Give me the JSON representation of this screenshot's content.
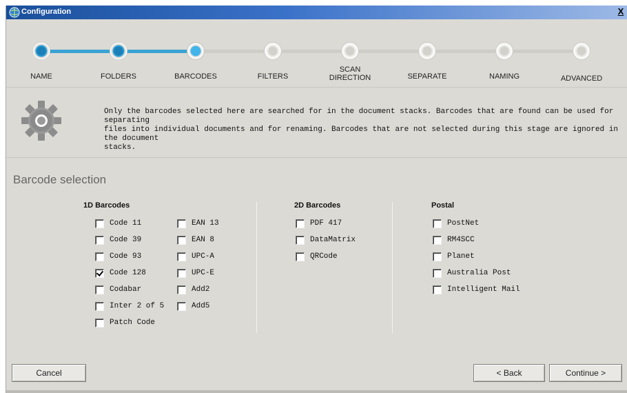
{
  "window": {
    "title": "Configuration",
    "close_label": "X"
  },
  "steps": [
    {
      "label": "NAME",
      "state": "done"
    },
    {
      "label": "FOLDERS",
      "state": "done"
    },
    {
      "label": "BARCODES",
      "state": "current"
    },
    {
      "label": "FILTERS",
      "state": "todo"
    },
    {
      "label": "SCAN\nDIRECTION",
      "state": "todo"
    },
    {
      "label": "SEPARATE",
      "state": "todo"
    },
    {
      "label": "NAMING",
      "state": "todo"
    },
    {
      "label": "ADVANCED",
      "state": "todo"
    }
  ],
  "info": {
    "icon": "gear-icon",
    "text": "Only the barcodes selected here are searched for in the document stacks. Barcodes that are found can be used for separating\nfiles into individual documents and for renaming. Barcodes that are not selected during this stage are ignored in the document\nstacks."
  },
  "section_title": "Barcode selection",
  "groups": {
    "oned": {
      "title": "1D Barcodes",
      "items": [
        {
          "label": "Code 11",
          "checked": false
        },
        {
          "label": "Code 39",
          "checked": false
        },
        {
          "label": "Code 93",
          "checked": false
        },
        {
          "label": "Code 128",
          "checked": true
        },
        {
          "label": "Codabar",
          "checked": false
        },
        {
          "label": "Inter 2 of 5",
          "checked": false
        },
        {
          "label": "Patch Code",
          "checked": false
        },
        {
          "label": "EAN 13",
          "checked": false
        },
        {
          "label": "EAN 8",
          "checked": false
        },
        {
          "label": "UPC-A",
          "checked": false
        },
        {
          "label": "UPC-E",
          "checked": false
        },
        {
          "label": "Add2",
          "checked": false
        },
        {
          "label": "Add5",
          "checked": false
        }
      ]
    },
    "twod": {
      "title": "2D Barcodes",
      "items": [
        {
          "label": "PDF 417",
          "checked": false
        },
        {
          "label": "DataMatrix",
          "checked": false
        },
        {
          "label": "QRCode",
          "checked": false
        }
      ]
    },
    "postal": {
      "title": "Postal",
      "items": [
        {
          "label": "PostNet",
          "checked": false
        },
        {
          "label": "RM4SCC",
          "checked": false
        },
        {
          "label": "Planet",
          "checked": false
        },
        {
          "label": "Australia Post",
          "checked": false
        },
        {
          "label": "Intelligent Mail",
          "checked": false
        }
      ]
    }
  },
  "buttons": {
    "cancel": "Cancel",
    "back": "< Back",
    "continue": "Continue >"
  },
  "colors": {
    "accent": "#3aa3d4",
    "titlebar": "#1a4f9b",
    "window_bg": "#dcdad5"
  }
}
